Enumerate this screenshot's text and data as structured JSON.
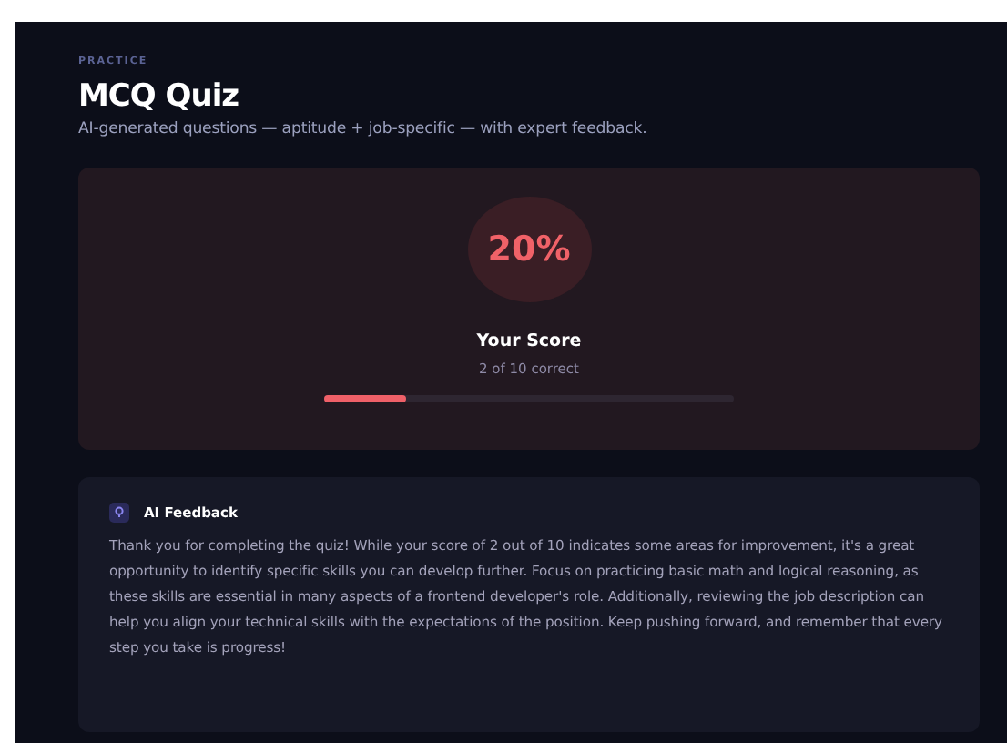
{
  "header": {
    "eyebrow": "PRACTICE",
    "title": "MCQ Quiz",
    "subtitle": "AI-generated questions — aptitude + job-specific — with expert feedback."
  },
  "score": {
    "percent": "20%",
    "label": "Your Score",
    "detail": "2 of 10 correct",
    "level": 0.2
  },
  "feedback": {
    "title": "AI Feedback",
    "text": "Thank you for completing the quiz! While your score of 2 out of 10 indicates some areas for improvement, it's a great opportunity to identify specific skills you can develop further. Focus on practicing basic math and logical reasoning, as these skills are essential in many aspects of a frontend developer's role. Additionally, reviewing the job description can help you align your technical skills with the expectations of the position. Keep pushing forward, and remember that every step you take is progress!"
  }
}
